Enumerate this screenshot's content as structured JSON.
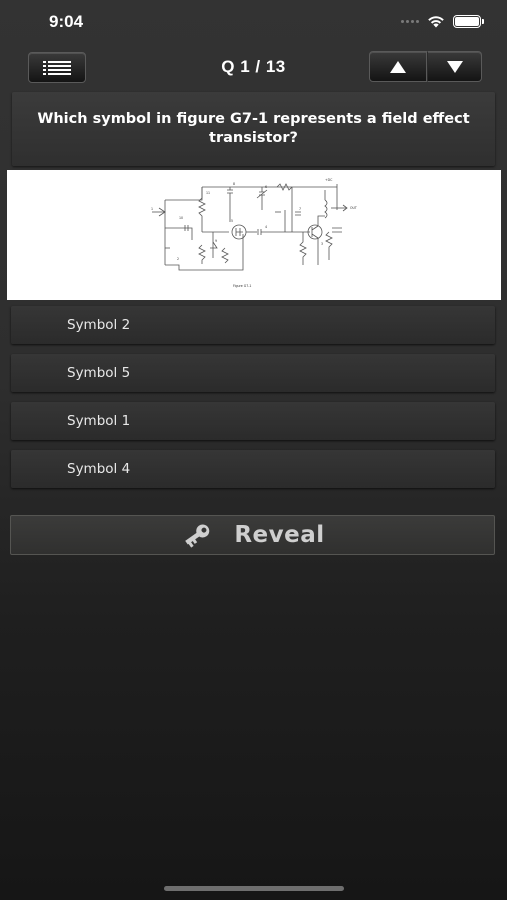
{
  "status_bar": {
    "time": "9:04"
  },
  "nav": {
    "title": "Q 1 / 13"
  },
  "question": {
    "text": "Which symbol in figure G7-1 represents a field effect transistor?"
  },
  "figure": {
    "caption": "Figure G7-1",
    "labels": {
      "vdc": "+DC",
      "out": "OUT",
      "n1": "1",
      "n2": "2",
      "n3": "3",
      "n4": "4",
      "n5": "5",
      "n6": "6",
      "n7": "7",
      "n8": "8",
      "n9": "9",
      "n10": "10",
      "n11": "11"
    }
  },
  "answers": [
    {
      "label": "Symbol 2"
    },
    {
      "label": "Symbol 5"
    },
    {
      "label": "Symbol 1"
    },
    {
      "label": "Symbol 4"
    }
  ],
  "reveal": {
    "label": "Reveal"
  },
  "colors": {
    "accent": "#ffffff",
    "panel": "#333333",
    "reveal_text": "#cfcfcf"
  }
}
